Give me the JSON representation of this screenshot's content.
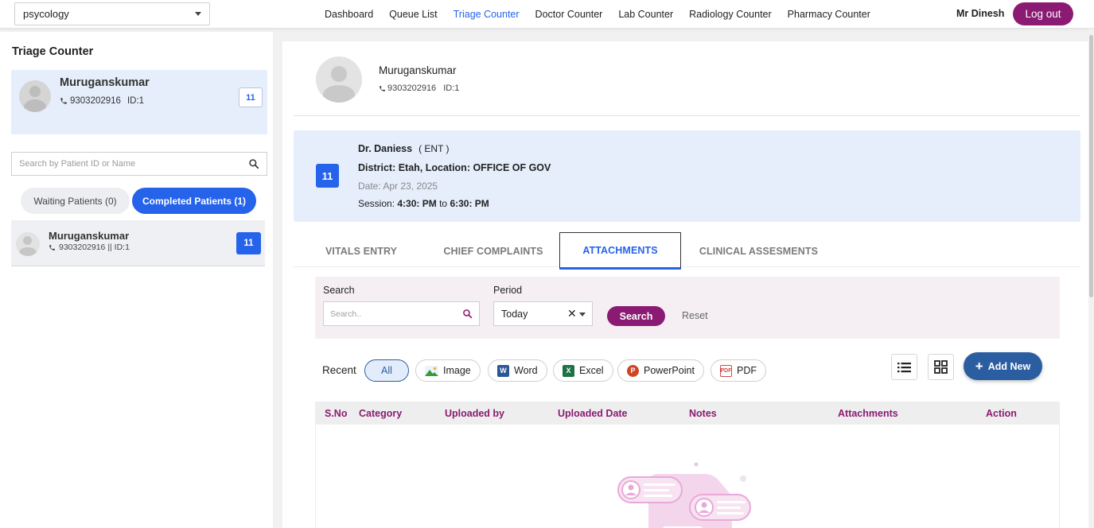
{
  "topbar": {
    "department": "psycology",
    "nav": [
      "Dashboard",
      "Queue List",
      "Triage Counter",
      "Doctor Counter",
      "Lab Counter",
      "Radiology Counter",
      "Pharmacy Counter"
    ],
    "active_nav": "Triage Counter",
    "user": "Mr Dinesh",
    "logout": "Log out"
  },
  "sidebar": {
    "title": "Triage Counter",
    "current_patient": {
      "name": "Muruganskumar",
      "phone": "9303202916",
      "id": "ID:1",
      "token": "11"
    },
    "search_placeholder": "Search by Patient ID or Name",
    "tabs": {
      "waiting": "Waiting Patients (0)",
      "completed": "Completed Patients (1)"
    },
    "patients": [
      {
        "name": "Muruganskumar",
        "meta": "9303202916 || ID:1",
        "token": "11"
      }
    ]
  },
  "main": {
    "patient": {
      "name": "Muruganskumar",
      "phone": "9303202916",
      "id": "ID:1"
    },
    "doctor_card": {
      "token": "11",
      "doctor": "Dr. Daniess",
      "department": "( ENT )",
      "district": "District: Etah, Location: OFFICE OF GOV",
      "date": "Date: Apr 23, 2025",
      "session_label": "Session:",
      "session_from": "4:30: PM",
      "session_to_word": "to",
      "session_to": "6:30: PM"
    },
    "tabs": [
      "VITALS ENTRY",
      "CHIEF COMPLAINTS",
      "ATTACHMENTS",
      "CLINICAL ASSESMENTS"
    ],
    "active_tab": "ATTACHMENTS",
    "filter": {
      "search_label": "Search",
      "search_placeholder": "Search..",
      "period_label": "Period",
      "period_value": "Today",
      "search_button": "Search",
      "reset_button": "Reset"
    },
    "recent": {
      "label": "Recent",
      "chips": [
        "All",
        "Image",
        "Word",
        "Excel",
        "PowerPoint",
        "PDF"
      ],
      "active_chip": "All",
      "add_new": "Add New"
    },
    "table": {
      "columns": [
        "S.No",
        "Category",
        "Uploaded by",
        "Uploaded Date",
        "Notes",
        "Attachments",
        "Action"
      ]
    }
  },
  "colors": {
    "primary_blue": "#2563eb",
    "brand_purple": "#8b1a73",
    "card_bg": "#e6eefc",
    "add_button": "#2b5ea0"
  }
}
